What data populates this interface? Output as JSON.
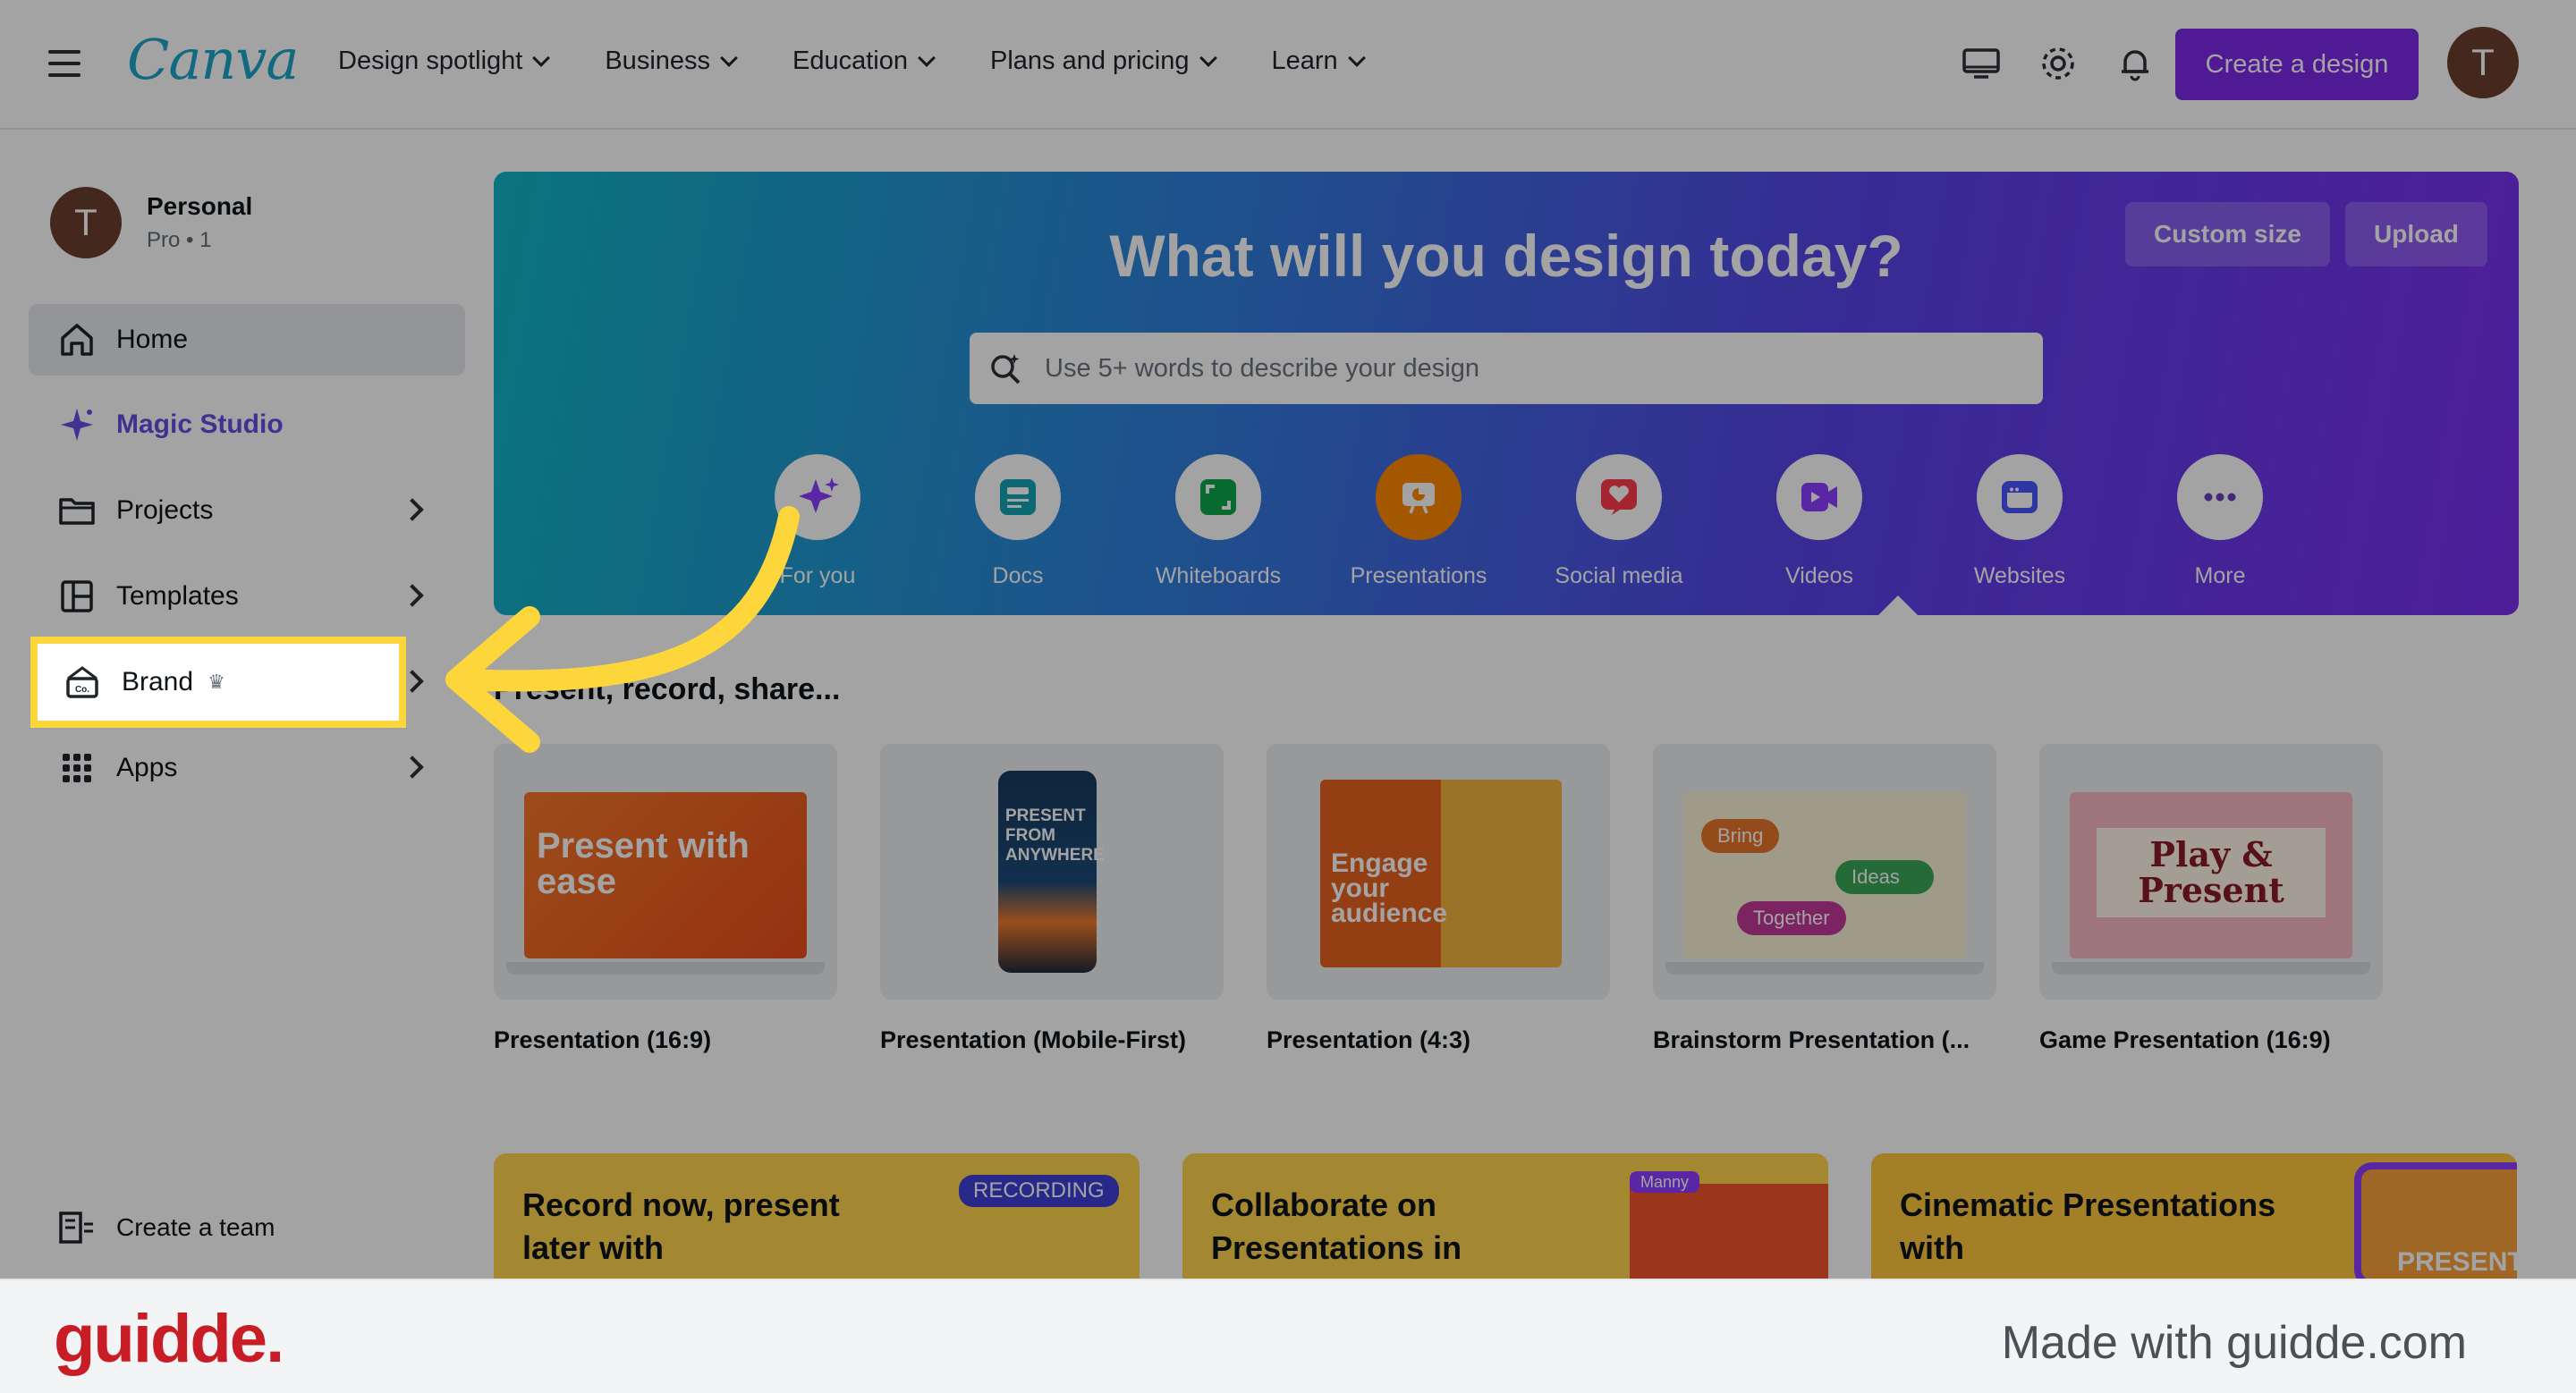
{
  "topbar": {
    "logo": "Canva",
    "nav": [
      "Design spotlight",
      "Business",
      "Education",
      "Plans and pricing",
      "Learn"
    ],
    "create_label": "Create a design",
    "avatar_initial": "T"
  },
  "sidebar": {
    "account": {
      "initial": "T",
      "name": "Personal",
      "plan": "Pro • 1"
    },
    "items": [
      {
        "label": "Home",
        "icon": "home-icon"
      },
      {
        "label": "Magic Studio",
        "icon": "sparkle-icon"
      },
      {
        "label": "Projects",
        "icon": "folder-icon"
      },
      {
        "label": "Templates",
        "icon": "templates-icon"
      },
      {
        "label": "Brand",
        "icon": "brand-icon"
      },
      {
        "label": "Apps",
        "icon": "apps-grid-icon"
      }
    ],
    "create_team": "Create a team"
  },
  "hero": {
    "title": "What will you design today?",
    "custom_size": "Custom size",
    "upload": "Upload",
    "search_placeholder": "Use 5+ words to describe your design",
    "categories": [
      "For you",
      "Docs",
      "Whiteboards",
      "Presentations",
      "Social media",
      "Videos",
      "Websites",
      "More"
    ],
    "category_colors": [
      "#8b3dff",
      "#13a3b5",
      "#0ba84a",
      "#ff8a00",
      "#ff3b4b",
      "#8b3dff",
      "#4a53ff",
      "#6b7280"
    ]
  },
  "presentations": {
    "title": "Present, record, share...",
    "cards": [
      {
        "caption": "Presentation (16:9)",
        "thumb_text": "Present with ease"
      },
      {
        "caption": "Presentation (Mobile-First)",
        "thumb_text": "PRESENT FROM ANYWHERE"
      },
      {
        "caption": "Presentation (4:3)",
        "thumb_text": "Engage your audience"
      },
      {
        "caption": "Brainstorm Presentation (...",
        "thumb_text": "Bring Ideas Together"
      },
      {
        "caption": "Game Presentation (16:9)",
        "thumb_text": "Play & Present"
      }
    ]
  },
  "promos": [
    {
      "title": "Record now, present later with",
      "badge": "RECORDING"
    },
    {
      "title": "Collaborate on Presentations in",
      "badge": "Manny"
    },
    {
      "title": "Cinematic Presentations with",
      "badge": "PRESENT"
    }
  ],
  "footer": {
    "logo": "guidde.",
    "text": "Made with guidde.com"
  },
  "colors": {
    "accent": "#7d2ae8",
    "highlight": "#fcd63a",
    "guidde_red": "#c81d25"
  }
}
